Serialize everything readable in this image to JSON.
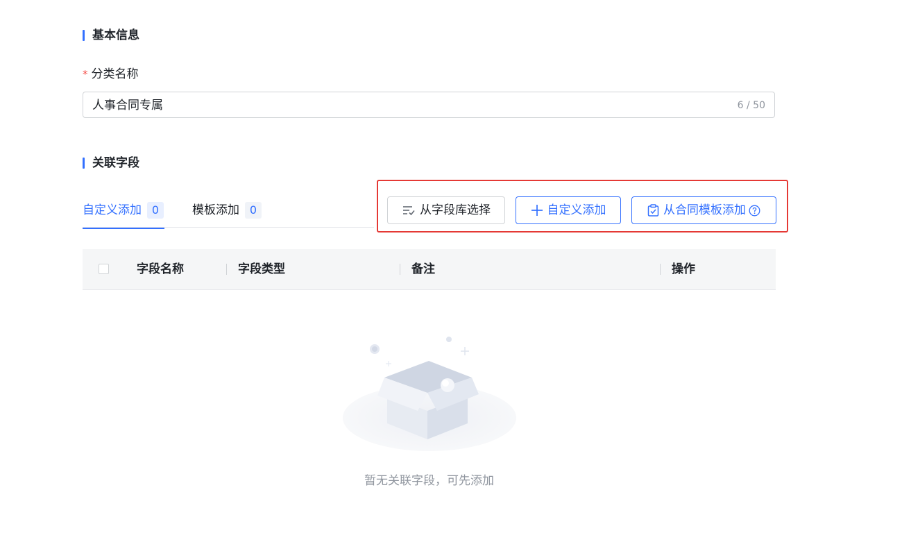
{
  "basic_info": {
    "title": "基本信息",
    "field_label": "分类名称",
    "required_mark": "*",
    "input_value": "人事合同专属",
    "char_count": "6 / 50"
  },
  "related_fields": {
    "title": "关联字段",
    "tabs": [
      {
        "label": "自定义添加",
        "count": "0",
        "active": true
      },
      {
        "label": "模板添加",
        "count": "0",
        "active": false
      }
    ],
    "buttons": {
      "from_library": "从字段库选择",
      "custom_add": "自定义添加",
      "from_template": "从合同模板添加"
    },
    "table": {
      "columns": [
        "字段名称",
        "字段类型",
        "备注",
        "操作"
      ]
    },
    "empty_text": "暂无关联字段，可先添加"
  },
  "colors": {
    "accent": "#3370ff",
    "highlight": "#e53935",
    "required": "#f54a45"
  },
  "icons": {
    "from_library": "list-check-icon",
    "custom_add": "plus-icon",
    "from_template": "clipboard-check-icon",
    "help": "question-circle-icon"
  }
}
